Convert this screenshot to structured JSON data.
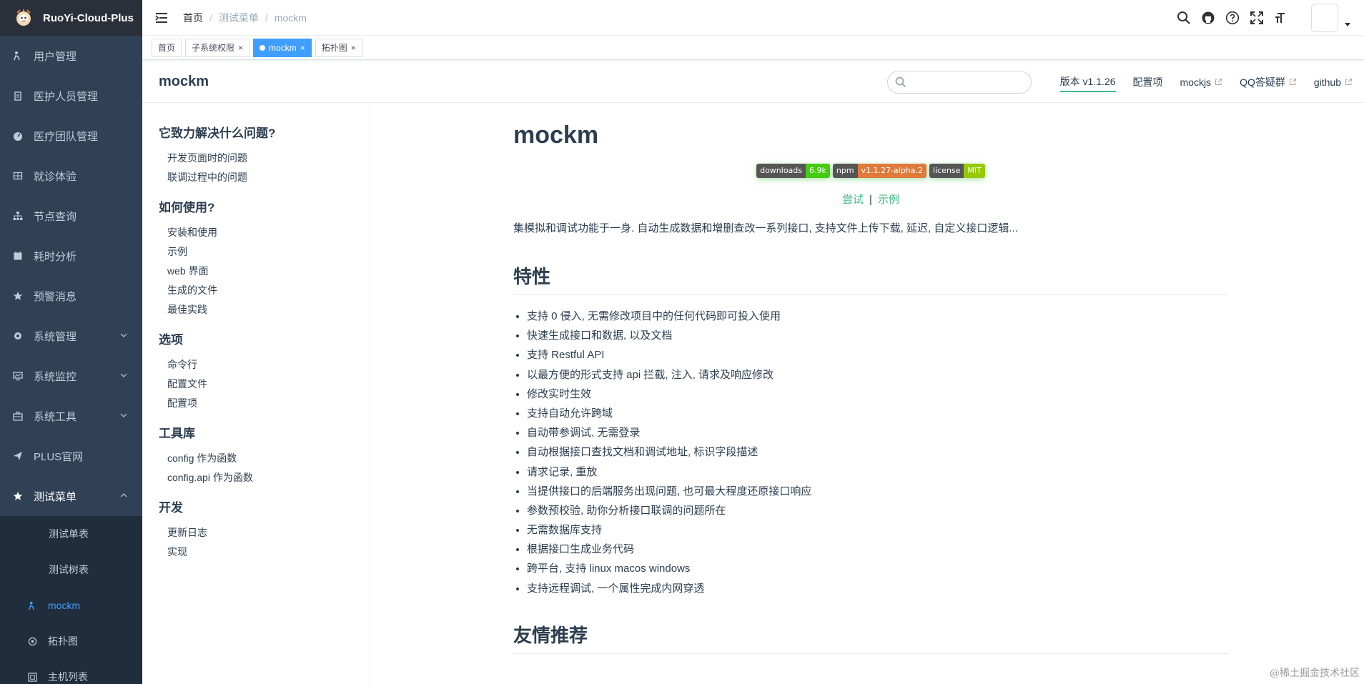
{
  "app": {
    "name": "RuoYi-Cloud-Plus"
  },
  "sidebar": {
    "items": [
      {
        "label": "用户管理",
        "icon": "user-icon"
      },
      {
        "label": "医护人员管理",
        "icon": "clipboard-icon"
      },
      {
        "label": "医疗团队管理",
        "icon": "dashboard-icon"
      },
      {
        "label": "就诊体验",
        "icon": "grid-icon"
      },
      {
        "label": "节点查询",
        "icon": "tree-icon"
      },
      {
        "label": "耗时分析",
        "icon": "calendar-icon"
      },
      {
        "label": "预警消息",
        "icon": "star-icon"
      },
      {
        "label": "系统管理",
        "icon": "gear-icon"
      },
      {
        "label": "系统监控",
        "icon": "monitor-icon"
      },
      {
        "label": "系统工具",
        "icon": "toolbox-icon"
      },
      {
        "label": "PLUS官网",
        "icon": "send-icon"
      },
      {
        "label": "测试菜单",
        "icon": "star-icon"
      }
    ],
    "submenu": [
      {
        "label": "测试单表"
      },
      {
        "label": "测试树表"
      },
      {
        "label": "mockm"
      },
      {
        "label": "拓扑图"
      },
      {
        "label": "主机列表"
      }
    ]
  },
  "breadcrumb": {
    "home": "首页",
    "parent": "测试菜单",
    "current": "mockm"
  },
  "tags": [
    {
      "label": "首页"
    },
    {
      "label": "子系统权限"
    },
    {
      "label": "mockm"
    },
    {
      "label": "拓扑图"
    }
  ],
  "doc": {
    "site_title": "mockm",
    "nav": {
      "version": "版本 v1.1.26",
      "config": "配置项",
      "mockjs": "mockjs",
      "qq": "QQ答疑群",
      "github": "github"
    },
    "toc": [
      {
        "group": "它致力解决什么问题?",
        "items": [
          "开发页面时的问题",
          "联调过程中的问题"
        ]
      },
      {
        "group": "如何使用?",
        "items": [
          "安装和使用",
          "示例",
          "web 界面",
          "生成的文件",
          "最佳实践"
        ]
      },
      {
        "group": "选项",
        "items": [
          "命令行",
          "配置文件",
          "配置项"
        ]
      },
      {
        "group": "工具库",
        "items": [
          "config 作为函数",
          "config.api 作为函数"
        ]
      },
      {
        "group": "开发",
        "items": [
          "更新日志",
          "实现"
        ]
      }
    ],
    "title": "mockm",
    "badges": [
      {
        "left": "downloads",
        "right": "6.9k",
        "color": "#4c1"
      },
      {
        "left": "npm",
        "right": "v1.1.27-alpha.2",
        "color": "#e07a3a"
      },
      {
        "left": "license",
        "right": "MIT",
        "color": "#97ca00"
      }
    ],
    "try": "尝试",
    "example": "示例",
    "description": "集模拟和调试功能于一身. 自动生成数据和增删查改一系列接口, 支持文件上传下载, 延迟, 自定义接口逻辑...",
    "features_title": "特性",
    "features": [
      "支持 0 侵入, 无需修改项目中的任何代码即可投入使用",
      "快速生成接口和数据, 以及文档",
      "支持 Restful API",
      "以最方便的形式支持 api 拦截, 注入, 请求及响应修改",
      "修改实时生效",
      "支持自动允许跨域",
      "自动带参调试, 无需登录",
      "自动根据接口查找文档和调试地址, 标识字段描述",
      "请求记录, 重放",
      "当提供接口的后端服务出现问题, 也可最大程度还原接口响应",
      "参数预校验, 助你分析接口联调的问题所在",
      "无需数据库支持",
      "根据接口生成业务代码",
      "跨平台, 支持 linux macos windows",
      "支持远程调试, 一个属性完成内网穿透"
    ],
    "recommend_title": "友情推荐"
  },
  "watermark": "@稀土掘金技术社区",
  "colors": {
    "sidebar_bg": "#304156",
    "active": "#409eff",
    "accent": "#42b983"
  }
}
